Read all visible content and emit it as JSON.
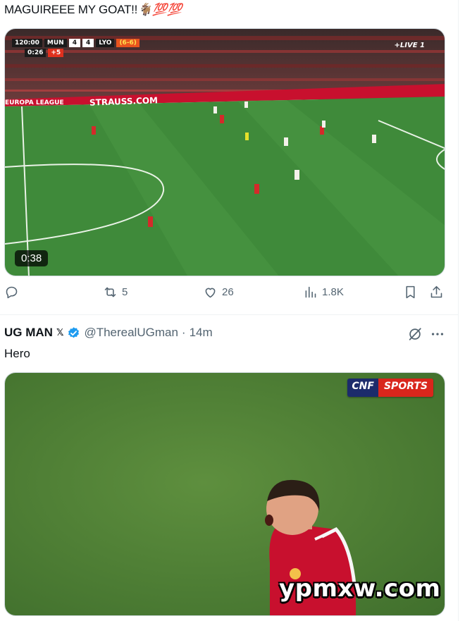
{
  "post1": {
    "text": "MAGUIREEE MY GOAT!!",
    "emoji": "🐐💯💯"
  },
  "video1": {
    "scoreboard": {
      "clock": "120:00",
      "home_team": "MUN",
      "home_score": "4",
      "away_score": "4",
      "away_team": "LYO",
      "aggregate": "(6-6)",
      "extra_clock": "0:26",
      "added_time": "+5"
    },
    "live_tag": "+LIVE 1",
    "board_text": "STRAUSS.COM",
    "competition": "EUROPA LEAGUE",
    "duration": "0:38"
  },
  "actions": {
    "reply_count": "",
    "retweet_count": "5",
    "like_count": "26",
    "views_count": "1.8K"
  },
  "tweet2": {
    "author_name": "UG MAN",
    "author_badge": "𝕏",
    "handle": "@TherealUGman",
    "separator": "·",
    "time": "14m",
    "body": "Hero"
  },
  "video2": {
    "logo_left": "CNF",
    "logo_right": "SPORTS",
    "watermark": "ypmxw.com"
  },
  "colors": {
    "accent_verified": "#1d9bf0",
    "muted_text": "#536471",
    "pitch_green": "#3f8a3a",
    "board_red": "#c8102e"
  }
}
